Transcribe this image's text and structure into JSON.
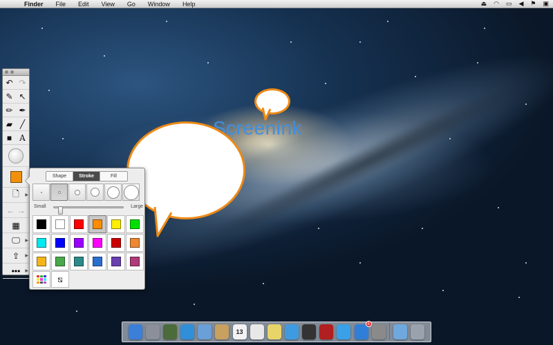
{
  "menubar": {
    "apple_icon": "apple-icon",
    "items": [
      {
        "label": "Finder",
        "bold": true
      },
      {
        "label": "File"
      },
      {
        "label": "Edit"
      },
      {
        "label": "View"
      },
      {
        "label": "Go"
      },
      {
        "label": "Window"
      },
      {
        "label": "Help"
      }
    ],
    "status_icons": [
      "eject-icon",
      "wifi-icon",
      "battery-icon",
      "volume-icon",
      "flag-icon",
      "display-icon"
    ]
  },
  "canvas": {
    "title_text": "Screenink",
    "title_color": "#3f8ee0",
    "bubble_border_color": "#ee8a16"
  },
  "toolbar": {
    "tools": [
      "undo-icon",
      "redo-icon",
      "highlighter-icon",
      "select-arrow-icon",
      "pen-icon",
      "brush-icon",
      "eraser-icon",
      "line-icon",
      "shape-icon",
      "text-icon"
    ],
    "text_tool_label": "A",
    "current_color": "#f2900c"
  },
  "popover": {
    "tabs": [
      {
        "label": "Shape",
        "active": false
      },
      {
        "label": "Stroke",
        "active": true
      },
      {
        "label": "Fill",
        "active": false
      }
    ],
    "slider": {
      "min_label": "Small",
      "max_label": "Large",
      "value": 0.06
    },
    "selected_size_index": 1,
    "colors": [
      "#000000",
      "#ffffff",
      "#ff0000",
      "#ff8c00",
      "#ffee00",
      "#00e000",
      "#00e8f0",
      "#0000ff",
      "#9a00ff",
      "#ff00ff",
      "#cc0000",
      "#ee8833",
      "#f5b51a",
      "#4aa84a",
      "#2d8a8a",
      "#2a6fd0",
      "#6a3fb0",
      "#b03a7a"
    ],
    "selected_color_index": 3
  },
  "dock": {
    "apps": [
      {
        "icon": "finder-icon",
        "color": "#3b7fd8"
      },
      {
        "icon": "launchpad-icon",
        "color": "#8a8f99"
      },
      {
        "icon": "mission-control-icon",
        "color": "#4b6b3a"
      },
      {
        "icon": "safari-icon",
        "color": "#2f8fd8"
      },
      {
        "icon": "mail-icon",
        "color": "#6a9fd8"
      },
      {
        "icon": "contacts-icon",
        "color": "#c8a060"
      },
      {
        "icon": "calendar-icon",
        "color": "#f2f2f2",
        "label": "13"
      },
      {
        "icon": "reminders-icon",
        "color": "#e8e8e8"
      },
      {
        "icon": "notes-icon",
        "color": "#e8d56a"
      },
      {
        "icon": "messages-icon",
        "color": "#3f9be0"
      },
      {
        "icon": "facetime-icon",
        "color": "#333333"
      },
      {
        "icon": "photo-booth-icon",
        "color": "#b02020"
      },
      {
        "icon": "itunes-icon",
        "color": "#3aa0e8"
      },
      {
        "icon": "app-store-icon",
        "color": "#2f7fd8",
        "badge": "8"
      },
      {
        "icon": "system-preferences-icon",
        "color": "#8a8a8a"
      },
      {
        "icon": "downloads-folder-icon",
        "color": "#6fa8dc"
      },
      {
        "icon": "trash-icon",
        "color": "#9aa3ad"
      }
    ]
  }
}
